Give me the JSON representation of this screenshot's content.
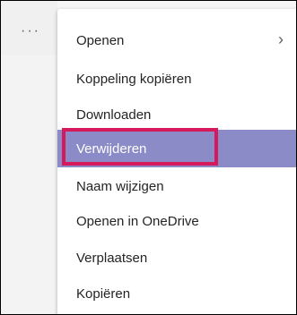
{
  "more_button": {
    "label": "···",
    "icon": "more-horizontal-icon"
  },
  "menu": {
    "items": [
      {
        "label": "Openen",
        "has_submenu": true,
        "chevron": "›"
      },
      {
        "label": "Koppeling kopiëren"
      },
      {
        "label": "Downloaden"
      },
      {
        "label": "Verwijderen",
        "selected": true
      },
      {
        "label": "Naam wijzigen"
      },
      {
        "label": "Openen in OneDrive"
      },
      {
        "label": "Verplaatsen"
      },
      {
        "label": "Kopiëren"
      }
    ]
  },
  "colors": {
    "selected_bg": "#8b8cc7",
    "annotation_border": "#d6185c",
    "text": "#252424"
  }
}
